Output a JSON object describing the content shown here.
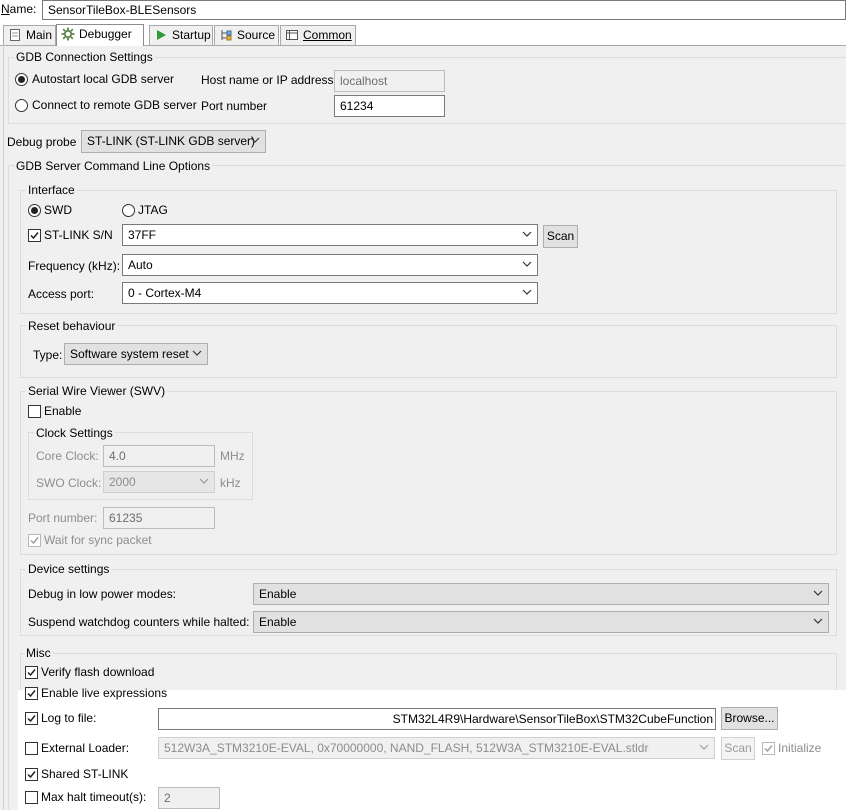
{
  "name_row": {
    "label": "Name:",
    "value": "SensorTileBox-BLESensors"
  },
  "tabs": [
    {
      "label": "Main",
      "icon": "main-tab-icon"
    },
    {
      "label": "Debugger",
      "icon": "debugger-tab-icon"
    },
    {
      "label": "Startup",
      "icon": "startup-play-icon"
    },
    {
      "label": "Source",
      "icon": "source-tab-icon"
    },
    {
      "label": "Common",
      "icon": "common-tab-icon"
    }
  ],
  "gdb_connection": {
    "title": "GDB Connection Settings",
    "autostart_label": "Autostart local GDB server",
    "remote_label": "Connect to remote GDB server",
    "host_label": "Host name or IP address",
    "host_value": "localhost",
    "port_label": "Port number",
    "port_value": "61234"
  },
  "debug_probe": {
    "label": "Debug probe",
    "value": "ST-LINK (ST-LINK GDB server)"
  },
  "server_options": {
    "title": "GDB Server Command Line Options"
  },
  "interface": {
    "title": "Interface",
    "swd_label": "SWD",
    "jtag_label": "JTAG",
    "stlink_sn_label": "ST-LINK S/N",
    "stlink_sn_value": "37FF",
    "scan_label": "Scan",
    "frequency_label": "Frequency (kHz):",
    "frequency_value": "Auto",
    "access_port_label": "Access port:",
    "access_port_value": "0 - Cortex-M4"
  },
  "reset": {
    "title": "Reset behaviour",
    "type_label": "Type:",
    "type_value": "Software system reset"
  },
  "swv": {
    "title": "Serial Wire Viewer (SWV)",
    "enable_label": "Enable",
    "clock_title": "Clock Settings",
    "core_clock_label": "Core Clock:",
    "core_clock_value": "4.0",
    "core_clock_unit": "MHz",
    "swo_clock_label": "SWO Clock:",
    "swo_clock_value": "2000",
    "swo_clock_unit": "kHz",
    "port_label": "Port number:",
    "port_value": "61235",
    "wait_sync_label": "Wait for sync packet"
  },
  "device": {
    "title": "Device settings",
    "low_power_label": "Debug in low power modes:",
    "low_power_value": "Enable",
    "watchdog_label": "Suspend watchdog counters while halted:",
    "watchdog_value": "Enable"
  },
  "misc": {
    "title": "Misc",
    "verify_flash_label": "Verify flash download",
    "live_expr_label": "Enable live expressions",
    "log_file_label": "Log to file:",
    "log_file_value": "STM32L4R9\\Hardware\\SensorTileBox\\STM32CubeFunction",
    "browse_label": "Browse...",
    "ext_loader_label": "External Loader:",
    "ext_loader_value": "512W3A_STM3210E-EVAL, 0x70000000, NAND_FLASH, 512W3A_STM3210E-EVAL.stldr",
    "ext_scan_label": "Scan",
    "initialize_label": "Initialize",
    "shared_stlink_label": "Shared ST-LINK",
    "max_halt_label": "Max halt timeout(s):",
    "max_halt_value": "2"
  }
}
